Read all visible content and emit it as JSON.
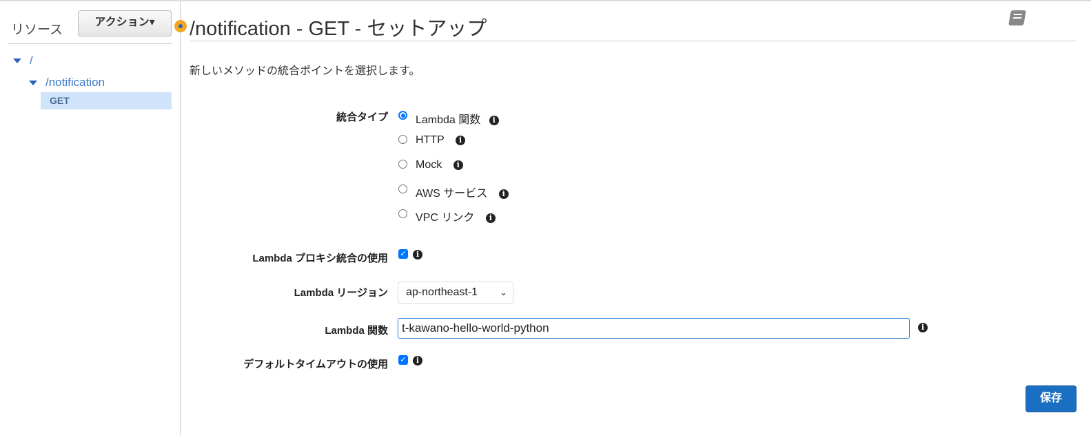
{
  "sidebar": {
    "title": "リソース",
    "actions_label": "アクション▾",
    "tree": [
      "/",
      "/notification",
      "GET"
    ]
  },
  "header": {
    "title": "/notification - GET - セットアップ"
  },
  "description": "新しいメソッドの統合ポイントを選択します。",
  "form": {
    "integration_type_label": "統合タイプ",
    "integration_options": [
      "Lambda 関数",
      "HTTP",
      "Mock",
      "AWS サービス",
      "VPC リンク"
    ],
    "proxy_label": "Lambda プロキシ統合の使用",
    "region_label": "Lambda リージョン",
    "region_value": "ap-northeast-1",
    "function_label": "Lambda 関数",
    "function_value": "t-kawano-hello-world-python",
    "timeout_label": "デフォルトタイムアウトの使用"
  },
  "save_label": "保存",
  "info_glyph": "i",
  "check_glyph": "✓"
}
